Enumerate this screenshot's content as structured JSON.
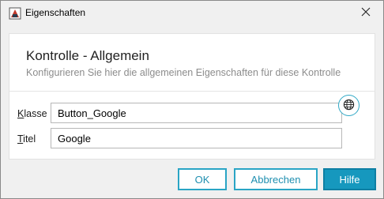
{
  "window": {
    "title": "Eigenschaften",
    "icon": "app-control-icon"
  },
  "header": {
    "heading": "Kontrolle - Allgemein",
    "description": "Konfigurieren Sie hier die allgemeinen Eigenschaften für diese Kontrolle"
  },
  "fields": {
    "klasse": {
      "mnemonic": "K",
      "label_rest": "lasse",
      "value": "Button_Google"
    },
    "titel": {
      "mnemonic": "T",
      "label_rest": "itel",
      "value": "Google"
    }
  },
  "buttons": {
    "ok": "OK",
    "cancel": "Abbrechen",
    "help": "Hilfe"
  },
  "colors": {
    "accent": "#1698be",
    "accent_border": "#2aa5c5"
  }
}
